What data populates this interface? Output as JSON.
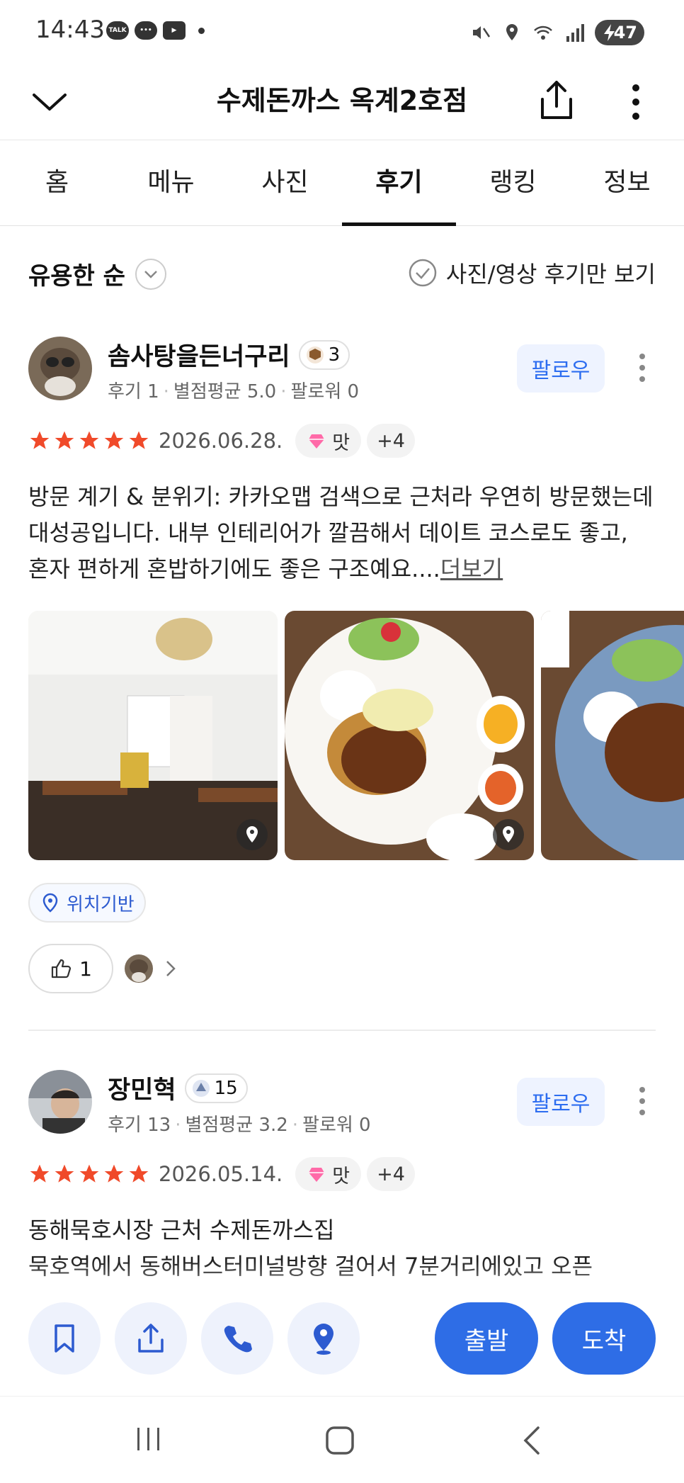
{
  "status": {
    "time": "14:43",
    "apps": [
      "TALK",
      "chat",
      "youtube"
    ],
    "battery": "47"
  },
  "header": {
    "title": "수제돈까스 옥계2호점"
  },
  "tabs": [
    {
      "label": "홈"
    },
    {
      "label": "메뉴"
    },
    {
      "label": "사진"
    },
    {
      "label": "후기",
      "active": true
    },
    {
      "label": "랭킹"
    },
    {
      "label": "정보"
    }
  ],
  "filter": {
    "sort_label": "유용한 순",
    "photo_only_label": "사진/영상 후기만 보기"
  },
  "reviews": [
    {
      "name": "솜사탕을든너구리",
      "level": "3",
      "meta": [
        "후기 1",
        "별점평균 5.0",
        "팔로워 0"
      ],
      "follow_label": "팔로우",
      "stars": 5,
      "date": "2026.06.28.",
      "tag": "맛",
      "tag_more": "+4",
      "text": "방문 계기 & 분위기: 카카오맵 검색으로 근처라 우연히 방문했는데 대성공입니다. 내부 인테리어가 깔끔해서 데이트 코스로도 좋고, 혼자 편하게 혼밥하기에도 좋은 구조예요....",
      "more_label": "더보기",
      "location_tag": "위치기반",
      "likes": "1"
    },
    {
      "name": "장민혁",
      "level": "15",
      "meta": [
        "후기 13",
        "별점평균 3.2",
        "팔로워 0"
      ],
      "follow_label": "팔로우",
      "stars": 5,
      "date": "2026.05.14.",
      "tag": "맛",
      "tag_more": "+4",
      "text_line1": "동해묵호시장 근처 수제돈까스집",
      "text_line2": "묵호역에서 동해버스터미널방향 걸어서 7분거리에있고 오픈"
    }
  ],
  "actions": {
    "depart_label": "출발",
    "arrive_label": "도착"
  },
  "colors": {
    "accent": "#2e6de6",
    "star": "#f04a2a",
    "follow_bg": "#eef3ff"
  }
}
